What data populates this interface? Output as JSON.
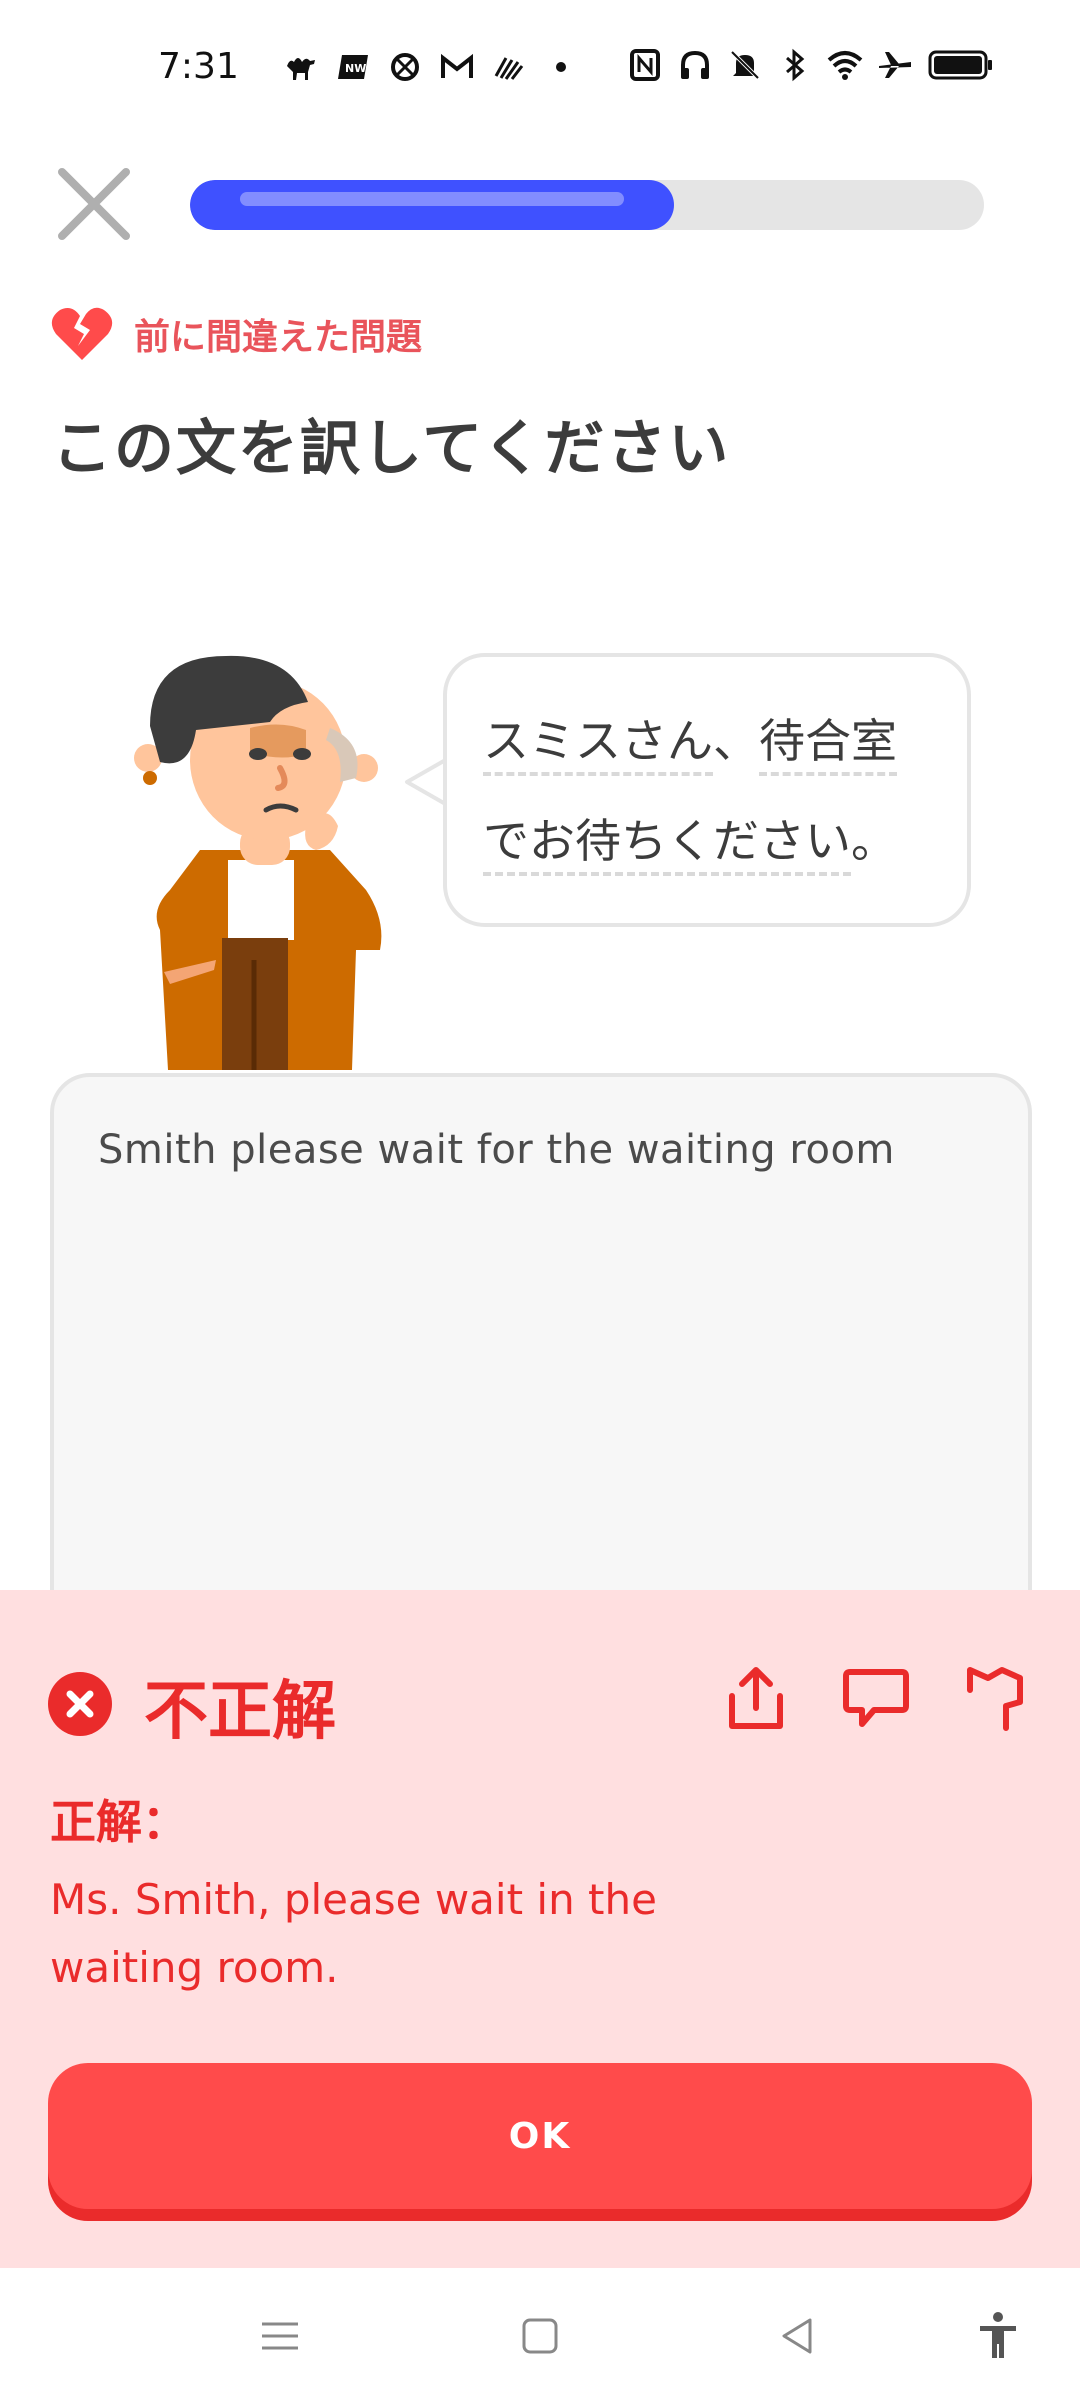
{
  "status_bar": {
    "time": "7:31",
    "left_icons": [
      "camel-icon",
      "news-icon",
      "app-icon",
      "gmail-icon",
      "wave-icon",
      "dot-icon"
    ],
    "right_icons": [
      "nfc-icon",
      "headphones-icon",
      "mute-icon",
      "bluetooth-icon",
      "wifi-icon",
      "airplane-icon",
      "battery-icon"
    ]
  },
  "lesson": {
    "progress": 0.61,
    "mistake_label": "前に間違えた問題",
    "prompt_title": "この文を訳してください",
    "sentence_line1": [
      "スミスさん",
      "、",
      "待合室"
    ],
    "sentence_line2": [
      "でお待ちください",
      "。"
    ]
  },
  "answer": {
    "text": "Smith please wait for the waiting room"
  },
  "feedback": {
    "title": "不正解",
    "correct_label": "正解：",
    "correct_answer": "Ms. Smith, please wait in the waiting room.",
    "ok_label": "OK"
  },
  "colors": {
    "progress": "#3f51ff",
    "error_red": "#ea2b2b",
    "feedback_bg": "#ffdfe0",
    "button_red": "#ff4b4b"
  }
}
